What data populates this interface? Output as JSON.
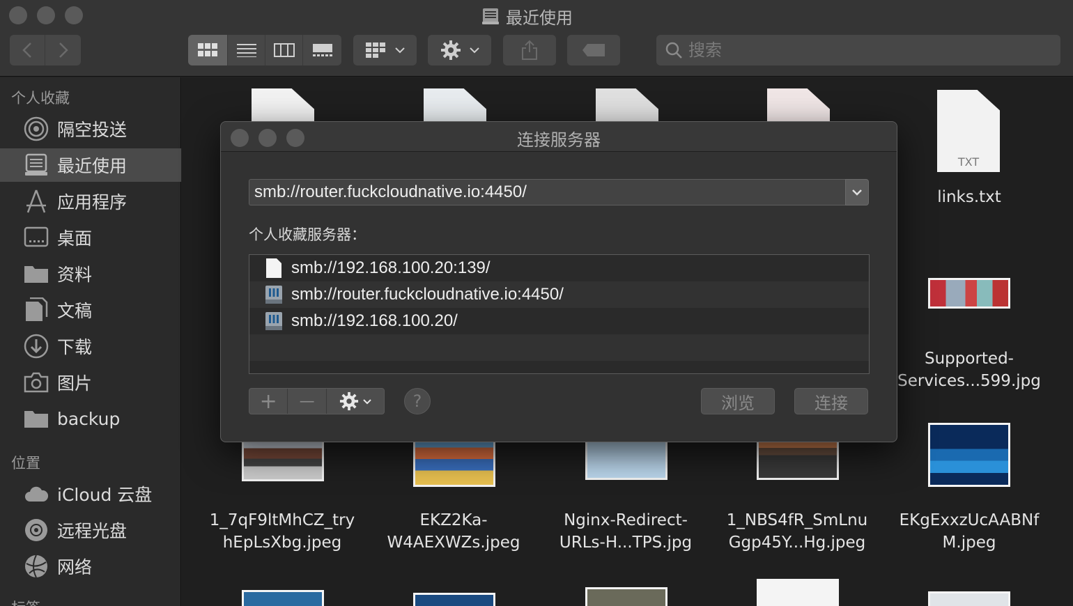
{
  "window": {
    "title": "最近使用"
  },
  "toolbar": {
    "search_placeholder": "搜索"
  },
  "sidebar": {
    "favorites_header": "个人收藏",
    "locations_header": "位置",
    "tags_header": "标签",
    "favorites": [
      {
        "label": "隔空投送",
        "icon": "airdrop-icon"
      },
      {
        "label": "最近使用",
        "icon": "recents-icon",
        "selected": true
      },
      {
        "label": "应用程序",
        "icon": "applications-icon"
      },
      {
        "label": "桌面",
        "icon": "desktop-icon"
      },
      {
        "label": "资料",
        "icon": "folder-icon"
      },
      {
        "label": "文稿",
        "icon": "documents-icon"
      },
      {
        "label": "下载",
        "icon": "downloads-icon"
      },
      {
        "label": "图片",
        "icon": "pictures-icon"
      },
      {
        "label": "backup",
        "icon": "folder-icon"
      }
    ],
    "locations": [
      {
        "label": "iCloud 云盘",
        "icon": "icloud-icon"
      },
      {
        "label": "远程光盘",
        "icon": "remote-disc-icon"
      },
      {
        "label": "网络",
        "icon": "network-icon"
      }
    ]
  },
  "files": {
    "links_txt": {
      "name": "links.txt",
      "badge": "TXT"
    },
    "supported": {
      "name_line1": "Supported-",
      "name_line2": "Services...599.jpg"
    },
    "row2": [
      {
        "line1": "1_7qF9ltMhCZ_try",
        "line2": "hEpLsXbg.jpeg"
      },
      {
        "line1": "EKZ2Ka-",
        "line2": "W4AEXWZs.jpeg"
      },
      {
        "line1": "Nginx-Redirect-",
        "line2": "URLs-H...TPS.jpg"
      },
      {
        "line1": "1_NBS4fR_SmLnu",
        "line2": "Ggp45Y...Hg.jpeg"
      },
      {
        "line1": "EKgExxzUcAABNf",
        "line2": "M.jpeg"
      }
    ]
  },
  "dialog": {
    "title": "连接服务器",
    "server_address": "smb://router.fuckcloudnative.io:4450/",
    "favorites_label": "个人收藏服务器：",
    "servers": [
      {
        "address": "smb://192.168.100.20:139/",
        "icon": "document-icon"
      },
      {
        "address": "smb://router.fuckcloudnative.io:4450/",
        "icon": "server-icon"
      },
      {
        "address": "smb://192.168.100.20/",
        "icon": "server-icon"
      }
    ],
    "add_symbol": "+",
    "remove_symbol": "—",
    "help_symbol": "?",
    "browse_label": "浏览",
    "connect_label": "连接"
  }
}
